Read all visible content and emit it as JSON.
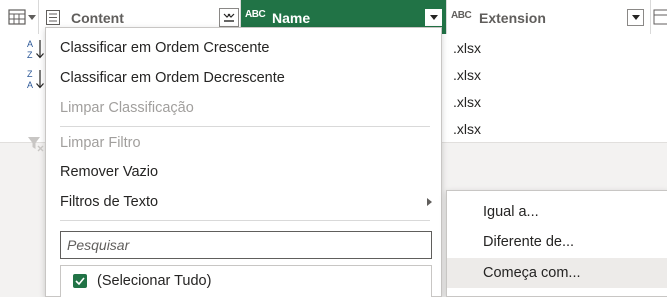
{
  "header": {
    "content_label": "Content",
    "name_label": "Name",
    "extension_label": "Extension",
    "abc_glyph": "ABC"
  },
  "rows": [
    {
      "extension": ".xlsx"
    },
    {
      "extension": ".xlsx"
    },
    {
      "extension": ".xlsx"
    },
    {
      "extension": ".xlsx"
    }
  ],
  "menu": {
    "sort_asc": "Classificar em Ordem Crescente",
    "sort_desc": "Classificar em Ordem Decrescente",
    "clear_sort": "Limpar Classificação",
    "clear_filter": "Limpar Filtro",
    "remove_empty": "Remover Vazio",
    "text_filters": "Filtros de Texto",
    "search_placeholder": "Pesquisar",
    "select_all": "(Selecionar Tudo)"
  },
  "submenu": {
    "equals": "Igual a...",
    "not_equals": "Diferente de...",
    "begins_with": "Começa com..."
  },
  "colors": {
    "accent": "#217346",
    "highlight": "#21b08a"
  }
}
